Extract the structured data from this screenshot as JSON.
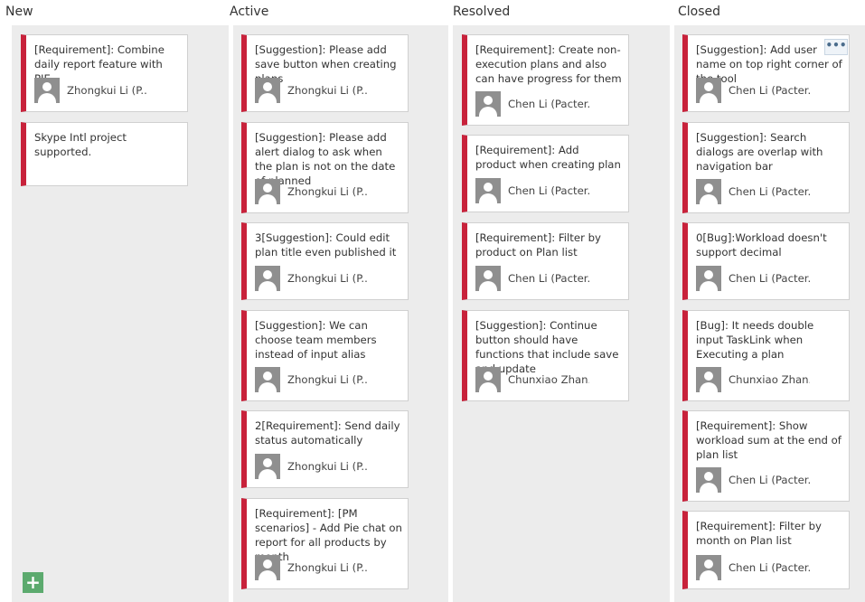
{
  "columns": [
    {
      "title": "New"
    },
    {
      "title": "Active"
    },
    {
      "title": "Resolved"
    },
    {
      "title": "Closed"
    }
  ],
  "cards": {
    "new": [
      {
        "title": "[Requirement]: Combine daily report feature with PIE",
        "assignee": "Zhongkui Li (P..."
      },
      {
        "title": "Skype Intl project supported.",
        "assignee": ""
      }
    ],
    "active": [
      {
        "title": "[Suggestion]: Please add save button when creating plans",
        "assignee": "Zhongkui Li (P..."
      },
      {
        "title": "[Suggestion]: Please add alert dialog to ask when the plan is not on the date of planned",
        "assignee": "Zhongkui Li (P..."
      },
      {
        "title": "3[Suggestion]: Could edit plan title even published it",
        "assignee": "Zhongkui Li (P..."
      },
      {
        "title": "[Suggestion]: We can choose team members instead of input alias",
        "assignee": "Zhongkui Li (P..."
      },
      {
        "title": "2[Requirement]: Send daily status automatically",
        "assignee": "Zhongkui Li (P..."
      },
      {
        "title": "[Requirement]: [PM scenarios] - Add Pie chat on report for all products by month",
        "assignee": "Zhongkui Li (P..."
      }
    ],
    "resolved": [
      {
        "title": "[Requirement]: Create non-execution plans and also can have progress for them",
        "assignee": "Chen Li (Pacter..."
      },
      {
        "title": "[Requirement]: Add product when creating plan",
        "assignee": "Chen Li (Pacter..."
      },
      {
        "title": "[Requirement]: Filter by product on Plan list",
        "assignee": "Chen Li (Pacter..."
      },
      {
        "title": "[Suggestion]: Continue button should have functions that include save and update",
        "assignee": "Chunxiao Zhan..."
      }
    ],
    "closed": [
      {
        "title": "[Suggestion]: Add user name on top right corner of the tool",
        "assignee": "Chen Li (Pacter..."
      },
      {
        "title": "[Suggestion]: Search dialogs are overlap with navigation bar",
        "assignee": "Chen Li (Pacter..."
      },
      {
        "title": "0[Bug]:Workload doesn't support decimal",
        "assignee": "Chen Li (Pacter..."
      },
      {
        "title": "[Bug]: It needs double input TaskLink when Executing a plan",
        "assignee": "Chunxiao Zhan..."
      },
      {
        "title": "[Requirement]: Show workload sum at the end of plan list",
        "assignee": "Chen Li (Pacter..."
      },
      {
        "title": "[Requirement]: Filter by month on Plan list",
        "assignee": "Chen Li (Pacter..."
      }
    ]
  },
  "more_button": {
    "label": "•••"
  },
  "add_button": {
    "label": "+"
  },
  "colors": {
    "accent": "#c8223b",
    "column_bg": "#ececec",
    "add_button": "#5caa6e"
  }
}
